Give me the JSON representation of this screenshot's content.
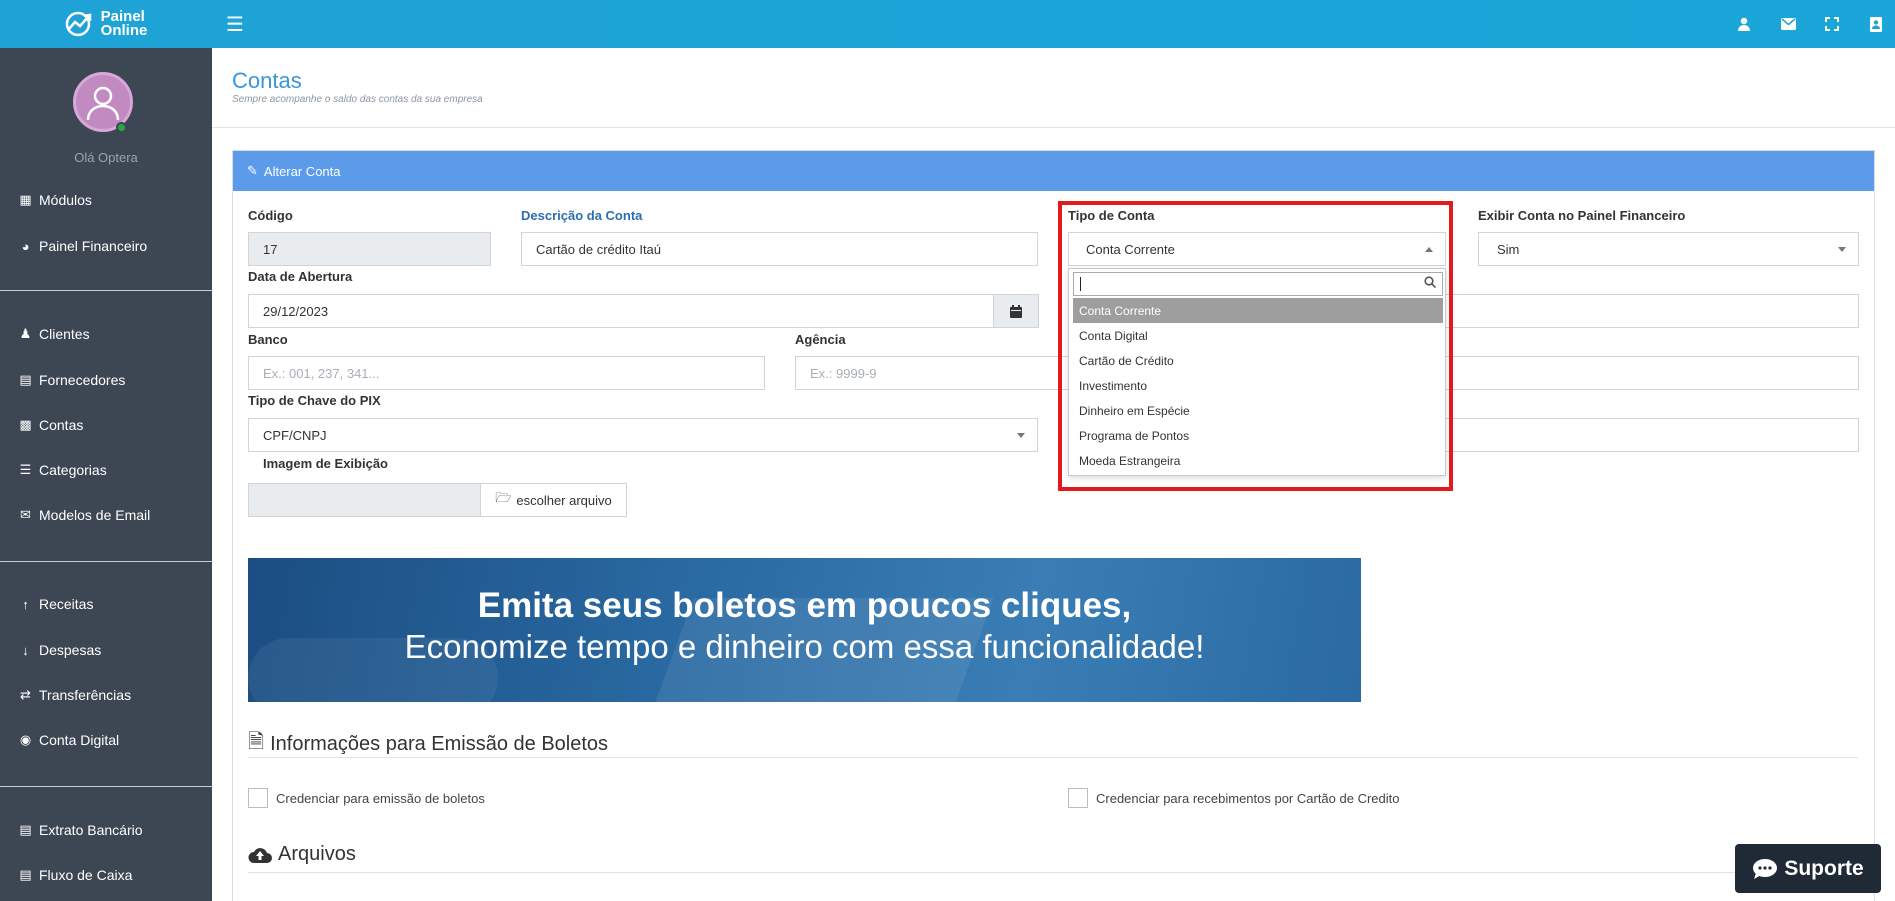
{
  "app": {
    "logo_line1": "Painel",
    "logo_line2": "Online"
  },
  "sidebar": {
    "greeting": "Olá Optera",
    "items": [
      {
        "label": "Módulos"
      },
      {
        "label": "Painel Financeiro"
      },
      {
        "label": "Clientes"
      },
      {
        "label": "Fornecedores"
      },
      {
        "label": "Contas"
      },
      {
        "label": "Categorias"
      },
      {
        "label": "Modelos de Email"
      },
      {
        "label": "Receitas"
      },
      {
        "label": "Despesas"
      },
      {
        "label": "Transferências"
      },
      {
        "label": "Conta Digital"
      },
      {
        "label": "Extrato Bancário"
      },
      {
        "label": "Fluxo de Caixa"
      }
    ]
  },
  "page": {
    "title": "Contas",
    "subtitle": "Sempre acompanhe o saldo das contas da sua empresa"
  },
  "form": {
    "header": "Alterar Conta",
    "codigo_label": "Código",
    "codigo_value": "17",
    "descricao_label": "Descrição da Conta",
    "descricao_value": "Cartão de crédito Itaú",
    "tipo_label": "Tipo de Conta",
    "tipo_value": "Conta Corrente",
    "exibir_label": "Exibir Conta no Painel Financeiro",
    "exibir_value": "Sim",
    "abertura_label": "Data de Abertura",
    "abertura_value": "29/12/2023",
    "banco_label": "Banco",
    "banco_placeholder": "Ex.: 001, 237, 341...",
    "agencia_label": "Agência",
    "agencia_placeholder": "Ex.: 9999-9",
    "pix_label": "Tipo de Chave do PIX",
    "pix_value": "CPF/CNPJ",
    "imagem_label": "Imagem de Exibição",
    "file_button": "escolher arquivo"
  },
  "dropdown": {
    "search_value": "",
    "options": [
      "Conta Corrente",
      "Conta Digital",
      "Cartão de Crédito",
      "Investimento",
      "Dinheiro em Espécie",
      "Programa de Pontos",
      "Moeda Estrangeira"
    ],
    "selected_index": 0
  },
  "banner": {
    "line1": "Emita seus boletos em poucos cliques,",
    "line2": "Economize tempo e dinheiro com essa funcionalidade!"
  },
  "boletos": {
    "title": "Informações para Emissão de Boletos",
    "check1": "Credenciar para emissão de boletos",
    "check2": "Credenciar para recebimentos por Cartão de Credito"
  },
  "arquivos": {
    "title": "Arquivos"
  },
  "support": {
    "label": "Suporte"
  },
  "colors": {
    "topbar": "#1fa3d6",
    "sidebar": "#3d4653",
    "card_header": "#5b9bea",
    "highlight": "#e3191c"
  }
}
